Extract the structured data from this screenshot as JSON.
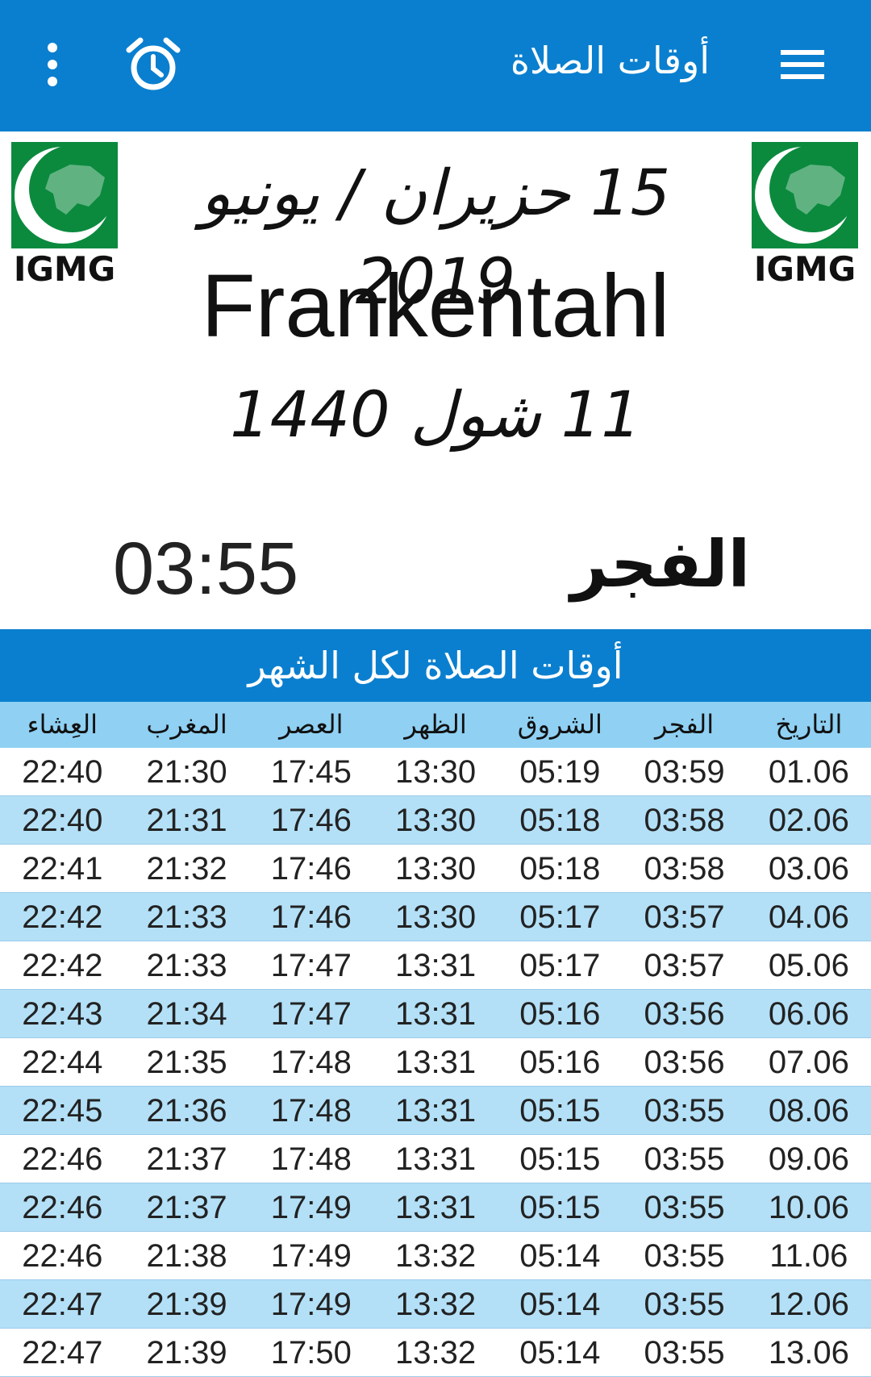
{
  "appbar": {
    "title": "أوقات الصلاة",
    "menu_icon": "hamburger-menu-icon",
    "alarm_icon": "alarm-clock-icon",
    "more_icon": "more-vertical-icon",
    "color": "#0a7fcf"
  },
  "header": {
    "gregorian_date": "15 حزيران / يونيو 2019",
    "city": "Frankentahl",
    "hijri_date": "11 شول 1440",
    "logo_text": "IGMG"
  },
  "current_prayer": {
    "name": "الفجر",
    "time": "03:55"
  },
  "month_table": {
    "title": "أوقات الصلاة لكل الشهر",
    "columns": [
      "التاريخ",
      "الفجر",
      "الشروق",
      "الظهر",
      "العصر",
      "المغرب",
      "العِشاء"
    ],
    "rows": [
      [
        "01.06",
        "03:59",
        "05:19",
        "13:30",
        "17:45",
        "21:30",
        "22:40"
      ],
      [
        "02.06",
        "03:58",
        "05:18",
        "13:30",
        "17:46",
        "21:31",
        "22:40"
      ],
      [
        "03.06",
        "03:58",
        "05:18",
        "13:30",
        "17:46",
        "21:32",
        "22:41"
      ],
      [
        "04.06",
        "03:57",
        "05:17",
        "13:30",
        "17:46",
        "21:33",
        "22:42"
      ],
      [
        "05.06",
        "03:57",
        "05:17",
        "13:31",
        "17:47",
        "21:33",
        "22:42"
      ],
      [
        "06.06",
        "03:56",
        "05:16",
        "13:31",
        "17:47",
        "21:34",
        "22:43"
      ],
      [
        "07.06",
        "03:56",
        "05:16",
        "13:31",
        "17:48",
        "21:35",
        "22:44"
      ],
      [
        "08.06",
        "03:55",
        "05:15",
        "13:31",
        "17:48",
        "21:36",
        "22:45"
      ],
      [
        "09.06",
        "03:55",
        "05:15",
        "13:31",
        "17:48",
        "21:37",
        "22:46"
      ],
      [
        "10.06",
        "03:55",
        "05:15",
        "13:31",
        "17:49",
        "21:37",
        "22:46"
      ],
      [
        "11.06",
        "03:55",
        "05:14",
        "13:32",
        "17:49",
        "21:38",
        "22:46"
      ],
      [
        "12.06",
        "03:55",
        "05:14",
        "13:32",
        "17:49",
        "21:39",
        "22:47"
      ],
      [
        "13.06",
        "03:55",
        "05:14",
        "13:32",
        "17:50",
        "21:39",
        "22:47"
      ]
    ],
    "header_color": "#8fd0f3",
    "alt_row_color": "#b3e0f7"
  }
}
